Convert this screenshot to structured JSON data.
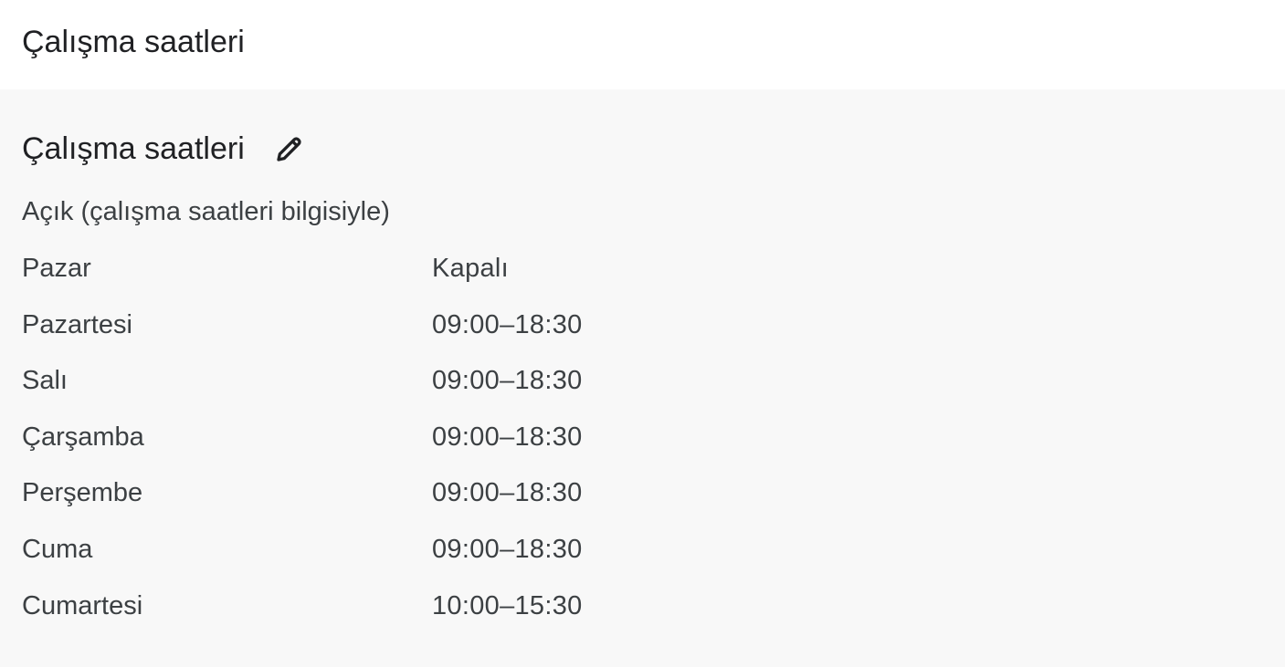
{
  "header": {
    "title": "Çalışma saatleri"
  },
  "section": {
    "title": "Çalışma saatleri",
    "edit_icon": "pencil-icon",
    "status": "Açık (çalışma saatleri bilgisiyle)"
  },
  "hours": [
    {
      "day": "Pazar",
      "time": "Kapalı"
    },
    {
      "day": "Pazartesi",
      "time": "09:00–18:30"
    },
    {
      "day": "Salı",
      "time": "09:00–18:30"
    },
    {
      "day": "Çarşamba",
      "time": "09:00–18:30"
    },
    {
      "day": "Perşembe",
      "time": "09:00–18:30"
    },
    {
      "day": "Cuma",
      "time": "09:00–18:30"
    },
    {
      "day": "Cumartesi",
      "time": "10:00–15:30"
    }
  ],
  "colors": {
    "text": "#202124",
    "secondary_text": "#3c4043",
    "panel_bg": "#f8f8f8"
  }
}
